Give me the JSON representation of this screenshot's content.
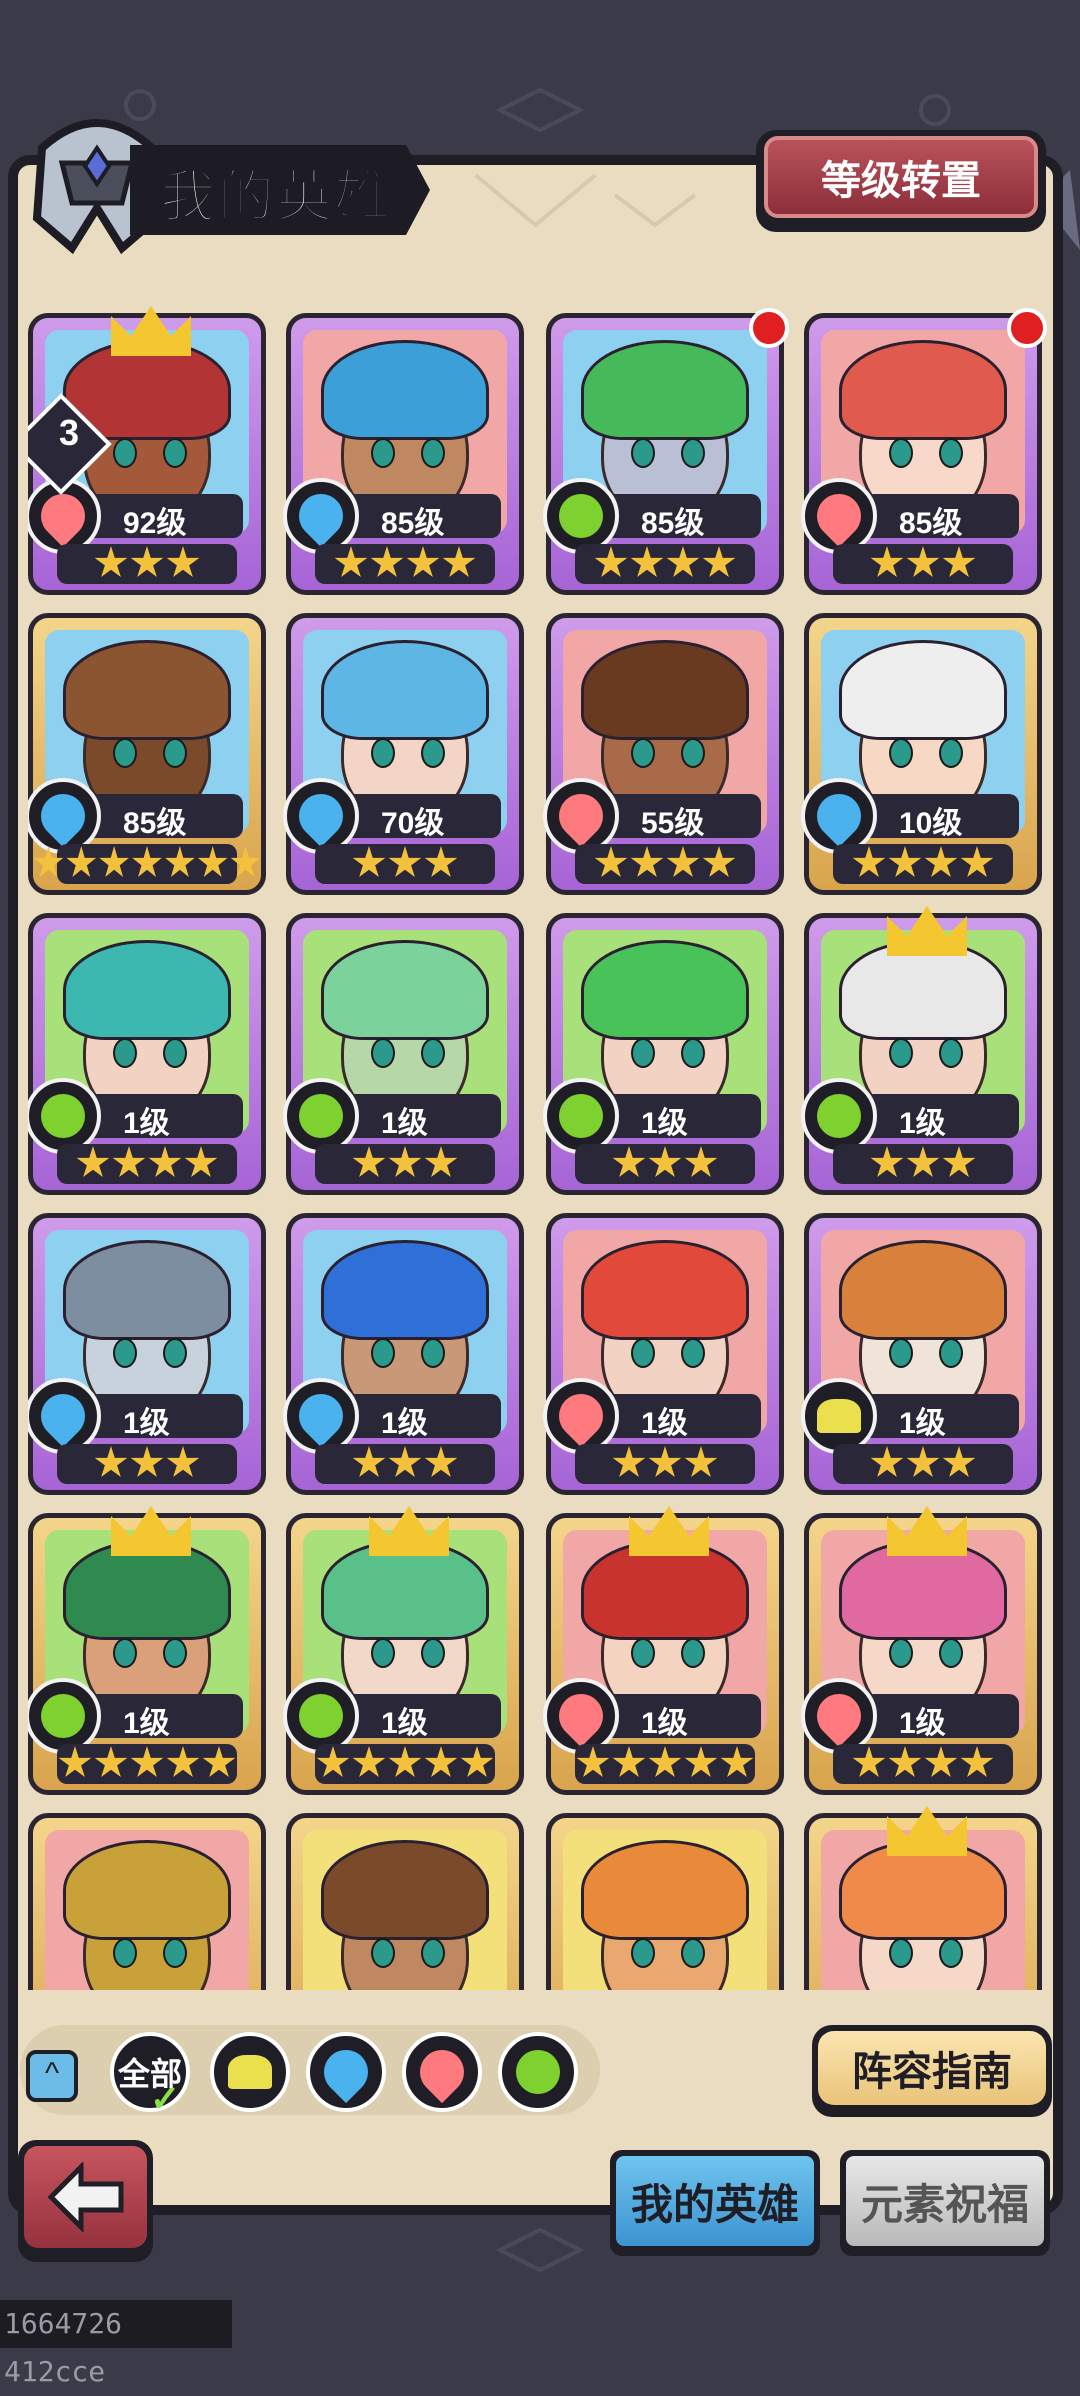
{
  "header": {
    "title": "我的英雄",
    "level_transfer_label": "等级转置"
  },
  "heroes": [
    {
      "level": "92级",
      "element": "fire",
      "frame": "purple",
      "stars": 3,
      "crown": true,
      "badge": "3",
      "hair": "#b33434",
      "skin": "#a45a3a",
      "bg": "#8ed0ef"
    },
    {
      "level": "85级",
      "element": "water",
      "frame": "purple",
      "stars": 4,
      "hair": "#3c9fd8",
      "skin": "#c08860",
      "bg": "#f2a7a7"
    },
    {
      "level": "85级",
      "element": "wind",
      "frame": "purple",
      "stars": 4,
      "reddot": true,
      "hair": "#46b95a",
      "skin": "#b9c0d6",
      "bg": "#8ed0ef"
    },
    {
      "level": "85级",
      "element": "fire",
      "frame": "purple",
      "stars": 3,
      "reddot": true,
      "hair": "#e05a4e",
      "skin": "#f8d8c8",
      "bg": "#f2a7a7"
    },
    {
      "level": "85级",
      "element": "water",
      "frame": "gold",
      "stars": 7,
      "hair": "#8a5530",
      "skin": "#7a4a2a",
      "bg": "#8ed0ef"
    },
    {
      "level": "70级",
      "element": "water",
      "frame": "purple",
      "stars": 3,
      "hair": "#5db6e3",
      "skin": "#f3d5c8",
      "bg": "#8ed0ef"
    },
    {
      "level": "55级",
      "element": "fire",
      "frame": "purple",
      "stars": 4,
      "hair": "#6a3a20",
      "skin": "#a86a48",
      "bg": "#f2a7a7"
    },
    {
      "level": "10级",
      "element": "water",
      "frame": "gold",
      "stars": 4,
      "hair": "#eeeeee",
      "skin": "#f6d8c4",
      "bg": "#8ed0ef"
    },
    {
      "level": "1级",
      "element": "wind",
      "frame": "purple",
      "stars": 4,
      "hair": "#3cb8b0",
      "skin": "#f2d2c2",
      "bg": "#a8e07a"
    },
    {
      "level": "1级",
      "element": "wind",
      "frame": "purple",
      "stars": 3,
      "hair": "#7bd39b",
      "skin": "#b6d7a8",
      "bg": "#a8e07a"
    },
    {
      "level": "1级",
      "element": "wind",
      "frame": "purple",
      "stars": 3,
      "hair": "#49c25a",
      "skin": "#f2d2c2",
      "bg": "#a8e07a"
    },
    {
      "level": "1级",
      "element": "wind",
      "frame": "purple",
      "stars": 3,
      "crown": true,
      "hair": "#e8e8e8",
      "skin": "#f2d2c2",
      "bg": "#a8e07a"
    },
    {
      "level": "1级",
      "element": "water",
      "frame": "purple",
      "stars": 3,
      "hair": "#7c8ea0",
      "skin": "#c8d2dc",
      "bg": "#8ed0ef"
    },
    {
      "level": "1级",
      "element": "water",
      "frame": "purple",
      "stars": 3,
      "hair": "#2f6fd8",
      "skin": "#c89878",
      "bg": "#8ed0ef"
    },
    {
      "level": "1级",
      "element": "fire",
      "frame": "purple",
      "stars": 3,
      "hair": "#e14a3a",
      "skin": "#f2d2c2",
      "bg": "#f2a7a7"
    },
    {
      "level": "1级",
      "element": "earth",
      "frame": "purple",
      "stars": 3,
      "hair": "#d8813c",
      "skin": "#f0e4d8",
      "bg": "#f2a7a7"
    },
    {
      "level": "1级",
      "element": "wind",
      "frame": "gold",
      "stars": 5,
      "crown": true,
      "hair": "#2f8a50",
      "skin": "#d9a07a",
      "bg": "#a8e07a"
    },
    {
      "level": "1级",
      "element": "wind",
      "frame": "gold",
      "stars": 5,
      "crown": true,
      "hair": "#59c08a",
      "skin": "#f2d8c8",
      "bg": "#a8e07a"
    },
    {
      "level": "1级",
      "element": "fire",
      "frame": "gold",
      "stars": 5,
      "crown": true,
      "hair": "#c8332e",
      "skin": "#f4d4c0",
      "bg": "#f2a7a7"
    },
    {
      "level": "1级",
      "element": "fire",
      "frame": "gold",
      "stars": 4,
      "crown": true,
      "hair": "#e06aa0",
      "skin": "#f6d8c8",
      "bg": "#f2a7a7"
    },
    {
      "level": "",
      "element": "fire",
      "frame": "gold",
      "stars": 0,
      "hair": "#c8a238",
      "skin": "#c8a238",
      "bg": "#f2a7a7"
    },
    {
      "level": "",
      "element": "earth",
      "frame": "gold",
      "stars": 0,
      "hair": "#7a4a2a",
      "skin": "#c08860",
      "bg": "#f4e07a"
    },
    {
      "level": "",
      "element": "earth",
      "frame": "gold",
      "stars": 0,
      "hair": "#e88a3a",
      "skin": "#e8a870",
      "bg": "#f4e07a"
    },
    {
      "level": "",
      "element": "fire",
      "frame": "gold",
      "stars": 0,
      "crown": true,
      "hair": "#f08a4a",
      "skin": "#f6d8c8",
      "bg": "#f2a7a7"
    }
  ],
  "filters": {
    "all_label": "全部",
    "elements": [
      "earth",
      "water",
      "fire",
      "wind"
    ]
  },
  "buttons": {
    "guide_label": "阵容指南",
    "back_icon": "back-arrow-icon"
  },
  "tabs": {
    "my_heroes": "我的英雄",
    "element_blessing": "元素祝福"
  },
  "footer": {
    "id_text": "1664726 412cce"
  },
  "colors": {
    "fire": "#ff7a7e",
    "water": "#4ab2ee",
    "wind": "#7ed12e",
    "earth": "#eadf4d"
  }
}
